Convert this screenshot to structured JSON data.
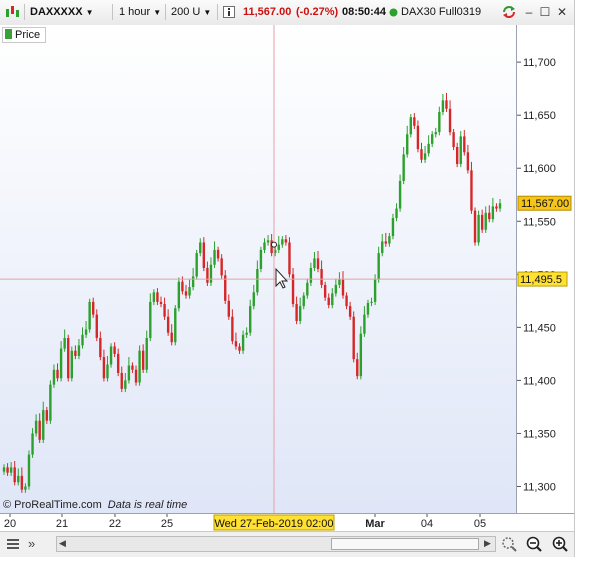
{
  "toolbar": {
    "symbol": "DAXXXXX",
    "timeframe": "1 hour",
    "units": "200 U",
    "price": "11,567.00",
    "change": "(-0.27%)",
    "time": "08:50:44",
    "instrument": "DAX30 Full0319"
  },
  "legend": {
    "label": "Price"
  },
  "footer": {
    "brand": "© ProRealTime.com",
    "note": "Data is real time"
  },
  "colors": {
    "up": "#2ca02c",
    "down": "#d62728",
    "crosshair": "#e8a0a8",
    "label_bg": "#ffe033",
    "last_price_bg": "#f5c518"
  },
  "crosshair": {
    "price_label": "11,495.5",
    "date_label": "Wed 27-Feb-2019 02:00",
    "price": 11495.5
  },
  "last_price": {
    "label": "11,567.00",
    "value": 11567
  },
  "chart_data": {
    "type": "candlestick",
    "title": "",
    "x_tick_labels": [
      "20",
      "21",
      "22",
      "25",
      "Mar",
      "04",
      "05"
    ],
    "y_tick_labels": [
      "11,700",
      "11,650",
      "11,600",
      "11,550",
      "11,500",
      "11,450",
      "11,400",
      "11,350",
      "11,300"
    ],
    "ylim": [
      11275,
      11735
    ],
    "grid": false,
    "series": [
      {
        "values": [
          11318,
          11313,
          11318,
          11304,
          11310,
          11297,
          11300,
          11330,
          11350,
          11362,
          11344,
          11372,
          11362,
          11396,
          11410,
          11402,
          11430,
          11440,
          11402,
          11428,
          11423,
          11433,
          11443,
          11448,
          11474,
          11462,
          11440,
          11422,
          11402,
          11415,
          11432,
          11425,
          11407,
          11392,
          11400,
          11414,
          11410,
          11398,
          11428,
          11410,
          11440,
          11474,
          11483,
          11474,
          11472,
          11460,
          11445,
          11436,
          11468,
          11493,
          11484,
          11480,
          11488,
          11498,
          11520,
          11530,
          11506,
          11492,
          11509,
          11523,
          11515,
          11499,
          11475,
          11460,
          11437,
          11432,
          11428,
          11443,
          11445,
          11470,
          11483,
          11505,
          11523,
          11530,
          11532,
          11520,
          11523,
          11528,
          11533,
          11530,
          11500,
          11472,
          11456,
          11470,
          11480,
          11492,
          11506,
          11515,
          11505,
          11490,
          11478,
          11471,
          11482,
          11490,
          11495,
          11480,
          11470,
          11460,
          11420,
          11404,
          11444,
          11462,
          11473,
          11474,
          11495,
          11520,
          11531,
          11529,
          11536,
          11553,
          11562,
          11588,
          11613,
          11632,
          11648,
          11640,
          11618,
          11608,
          11614,
          11623,
          11632,
          11634,
          11653,
          11664,
          11656,
          11634,
          11620,
          11604,
          11630,
          11615,
          11598,
          11560,
          11530,
          11556,
          11542,
          11558,
          11552,
          11564,
          11562,
          11567
        ]
      }
    ]
  }
}
